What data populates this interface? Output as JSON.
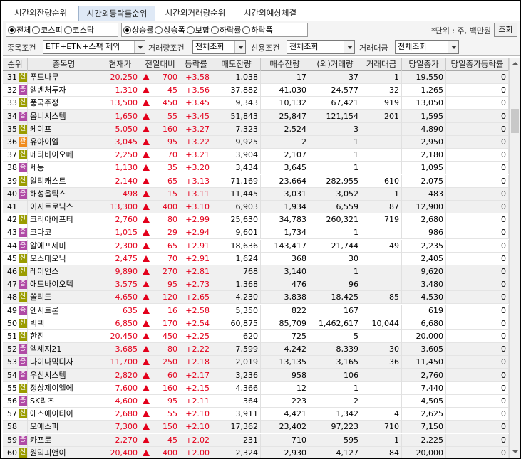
{
  "tabs": [
    {
      "label": "시간외잔량순위",
      "active": false
    },
    {
      "label": "시간외등락률순위",
      "active": true
    },
    {
      "label": "시간외거래량순위",
      "active": false
    },
    {
      "label": "시간외예상체결",
      "active": false
    }
  ],
  "market_options": [
    {
      "label": "전체",
      "selected": true
    },
    {
      "label": "코스피",
      "selected": false
    },
    {
      "label": "코스닥",
      "selected": false
    }
  ],
  "sort_options": [
    {
      "label": "상승률",
      "selected": true
    },
    {
      "label": "상승폭",
      "selected": false
    },
    {
      "label": "보합",
      "selected": false
    },
    {
      "label": "하락률",
      "selected": false
    },
    {
      "label": "하락폭",
      "selected": false
    }
  ],
  "unit_text": "*단위 : 주, 백만원",
  "lookup_button": "조회",
  "filters": {
    "stock_condition_label": "종목조건",
    "stock_condition_value": "ETF+ETN+스팩 제외",
    "volume_condition_label": "거래량조건",
    "volume_condition_value": "전체조회",
    "credit_condition_label": "신용조건",
    "credit_condition_value": "전체조회",
    "amount_label": "거래대금",
    "amount_value": "전체조회"
  },
  "columns": [
    "순위",
    "종목명",
    "현재가",
    "전일대비",
    "등락률",
    "매도잔량",
    "매수잔량",
    "(외)거래량",
    "거래대금",
    "당일종가",
    "당일종가등락률"
  ],
  "badge_colors": {
    "신": "#9a9c00",
    "증": "#b04aa5",
    "관": "#f08c1e"
  },
  "rows": [
    {
      "rank": "31",
      "badge": "신",
      "name": "푸드나무",
      "price": "20,250",
      "change": "700",
      "rate": "+3.58",
      "ask": "1,038",
      "bid": "17",
      "volume": "37",
      "amount": "1",
      "close": "19,550",
      "close_rate": "0",
      "up": true
    },
    {
      "rank": "32",
      "badge": "증",
      "name": "엠벤처투자",
      "price": "1,310",
      "change": "45",
      "rate": "+3.56",
      "ask": "37,882",
      "bid": "41,030",
      "volume": "24,577",
      "amount": "32",
      "close": "1,265",
      "close_rate": "0",
      "up": true
    },
    {
      "rank": "33",
      "badge": "신",
      "name": "풍국주정",
      "price": "13,500",
      "change": "450",
      "rate": "+3.45",
      "ask": "9,343",
      "bid": "10,132",
      "volume": "67,421",
      "amount": "919",
      "close": "13,050",
      "close_rate": "0",
      "up": true
    },
    {
      "rank": "34",
      "badge": "증",
      "name": "옵니시스템",
      "price": "1,650",
      "change": "55",
      "rate": "+3.45",
      "ask": "51,843",
      "bid": "25,847",
      "volume": "121,154",
      "amount": "201",
      "close": "1,595",
      "close_rate": "0",
      "up": true
    },
    {
      "rank": "35",
      "badge": "신",
      "name": "케이프",
      "price": "5,050",
      "change": "160",
      "rate": "+3.27",
      "ask": "7,323",
      "bid": "2,524",
      "volume": "3",
      "amount": "",
      "close": "4,890",
      "close_rate": "0",
      "up": true
    },
    {
      "rank": "36",
      "badge": "관",
      "name": "유아이엘",
      "price": "3,045",
      "change": "95",
      "rate": "+3.22",
      "ask": "9,925",
      "bid": "2",
      "volume": "1",
      "amount": "",
      "close": "2,950",
      "close_rate": "0",
      "up": true
    },
    {
      "rank": "37",
      "badge": "신",
      "name": "메타바이오메",
      "price": "2,250",
      "change": "70",
      "rate": "+3.21",
      "ask": "3,904",
      "bid": "2,107",
      "volume": "1",
      "amount": "",
      "close": "2,180",
      "close_rate": "0",
      "up": true
    },
    {
      "rank": "38",
      "badge": "증",
      "name": "세동",
      "price": "1,130",
      "change": "35",
      "rate": "+3.20",
      "ask": "3,434",
      "bid": "3,645",
      "volume": "1",
      "amount": "",
      "close": "1,095",
      "close_rate": "0",
      "up": true
    },
    {
      "rank": "39",
      "badge": "신",
      "name": "알티캐스트",
      "price": "2,140",
      "change": "65",
      "rate": "+3.13",
      "ask": "71,169",
      "bid": "23,664",
      "volume": "282,955",
      "amount": "610",
      "close": "2,075",
      "close_rate": "0",
      "up": true
    },
    {
      "rank": "40",
      "badge": "증",
      "name": "해성옵틱스",
      "price": "498",
      "change": "15",
      "rate": "+3.11",
      "ask": "11,445",
      "bid": "3,031",
      "volume": "3,052",
      "amount": "1",
      "close": "483",
      "close_rate": "0",
      "up": true
    },
    {
      "rank": "41",
      "badge": "",
      "name": "이지트로닉스",
      "price": "13,300",
      "change": "400",
      "rate": "+3.10",
      "ask": "6,903",
      "bid": "1,934",
      "volume": "6,559",
      "amount": "87",
      "close": "12,900",
      "close_rate": "0",
      "up": true
    },
    {
      "rank": "42",
      "badge": "신",
      "name": "코리아에프티",
      "price": "2,760",
      "change": "80",
      "rate": "+2.99",
      "ask": "25,630",
      "bid": "34,783",
      "volume": "260,321",
      "amount": "719",
      "close": "2,680",
      "close_rate": "0",
      "up": true
    },
    {
      "rank": "43",
      "badge": "증",
      "name": "코다코",
      "price": "1,015",
      "change": "29",
      "rate": "+2.94",
      "ask": "9,601",
      "bid": "1,734",
      "volume": "1",
      "amount": "",
      "close": "986",
      "close_rate": "0",
      "up": true
    },
    {
      "rank": "44",
      "badge": "증",
      "name": "알에프세미",
      "price": "2,300",
      "change": "65",
      "rate": "+2.91",
      "ask": "18,636",
      "bid": "143,417",
      "volume": "21,744",
      "amount": "49",
      "close": "2,235",
      "close_rate": "0",
      "up": true
    },
    {
      "rank": "45",
      "badge": "신",
      "name": "오스테오닉",
      "price": "2,475",
      "change": "70",
      "rate": "+2.91",
      "ask": "1,624",
      "bid": "368",
      "volume": "30",
      "amount": "",
      "close": "2,405",
      "close_rate": "0",
      "up": true
    },
    {
      "rank": "46",
      "badge": "신",
      "name": "레이언스",
      "price": "9,890",
      "change": "270",
      "rate": "+2.81",
      "ask": "768",
      "bid": "3,140",
      "volume": "1",
      "amount": "",
      "close": "9,620",
      "close_rate": "0",
      "up": true
    },
    {
      "rank": "47",
      "badge": "증",
      "name": "애드바이오텍",
      "price": "3,575",
      "change": "95",
      "rate": "+2.73",
      "ask": "1,368",
      "bid": "476",
      "volume": "96",
      "amount": "",
      "close": "3,480",
      "close_rate": "0",
      "up": true
    },
    {
      "rank": "48",
      "badge": "신",
      "name": "쏠리드",
      "price": "4,650",
      "change": "120",
      "rate": "+2.65",
      "ask": "4,230",
      "bid": "3,838",
      "volume": "18,425",
      "amount": "85",
      "close": "4,530",
      "close_rate": "0",
      "up": true
    },
    {
      "rank": "49",
      "badge": "증",
      "name": "엔시트론",
      "price": "635",
      "change": "16",
      "rate": "+2.58",
      "ask": "5,350",
      "bid": "822",
      "volume": "167",
      "amount": "",
      "close": "619",
      "close_rate": "0",
      "up": true
    },
    {
      "rank": "50",
      "badge": "신",
      "name": "빅텍",
      "price": "6,850",
      "change": "170",
      "rate": "+2.54",
      "ask": "60,875",
      "bid": "85,709",
      "volume": "1,462,617",
      "amount": "10,044",
      "close": "6,680",
      "close_rate": "0",
      "up": true
    },
    {
      "rank": "51",
      "badge": "신",
      "name": "한진",
      "price": "20,450",
      "change": "450",
      "rate": "+2.25",
      "ask": "620",
      "bid": "725",
      "volume": "5",
      "amount": "",
      "close": "20,000",
      "close_rate": "0",
      "up": true
    },
    {
      "rank": "52",
      "badge": "증",
      "name": "엑세지21",
      "price": "3,685",
      "change": "80",
      "rate": "+2.22",
      "ask": "7,599",
      "bid": "4,242",
      "volume": "8,339",
      "amount": "30",
      "close": "3,605",
      "close_rate": "0",
      "up": true
    },
    {
      "rank": "53",
      "badge": "증",
      "name": "다이나믹디자",
      "price": "11,700",
      "change": "250",
      "rate": "+2.18",
      "ask": "2,019",
      "bid": "13,135",
      "volume": "3,165",
      "amount": "36",
      "close": "11,450",
      "close_rate": "0",
      "up": true
    },
    {
      "rank": "54",
      "badge": "증",
      "name": "우신시스템",
      "price": "2,820",
      "change": "60",
      "rate": "+2.17",
      "ask": "3,236",
      "bid": "958",
      "volume": "106",
      "amount": "",
      "close": "2,760",
      "close_rate": "0",
      "up": true
    },
    {
      "rank": "55",
      "badge": "신",
      "name": "정상제이엘에",
      "price": "7,600",
      "change": "160",
      "rate": "+2.15",
      "ask": "4,366",
      "bid": "12",
      "volume": "1",
      "amount": "",
      "close": "7,440",
      "close_rate": "0",
      "up": true
    },
    {
      "rank": "56",
      "badge": "증",
      "name": "SK리츠",
      "price": "4,600",
      "change": "95",
      "rate": "+2.11",
      "ask": "364",
      "bid": "223",
      "volume": "2",
      "amount": "",
      "close": "4,505",
      "close_rate": "0",
      "up": true
    },
    {
      "rank": "57",
      "badge": "신",
      "name": "에스에이티이",
      "price": "2,680",
      "change": "55",
      "rate": "+2.10",
      "ask": "3,911",
      "bid": "4,421",
      "volume": "1,342",
      "amount": "4",
      "close": "2,625",
      "close_rate": "0",
      "up": true
    },
    {
      "rank": "58",
      "badge": "",
      "name": "오에스피",
      "price": "7,300",
      "change": "150",
      "rate": "+2.10",
      "ask": "17,362",
      "bid": "23,402",
      "volume": "97,223",
      "amount": "710",
      "close": "7,150",
      "close_rate": "0",
      "up": true
    },
    {
      "rank": "59",
      "badge": "증",
      "name": "카프로",
      "price": "2,270",
      "change": "45",
      "rate": "+2.02",
      "ask": "231",
      "bid": "710",
      "volume": "595",
      "amount": "1",
      "close": "2,225",
      "close_rate": "0",
      "up": true
    },
    {
      "rank": "60",
      "badge": "신",
      "name": "원익피앤이",
      "price": "20,400",
      "change": "400",
      "rate": "+2.00",
      "ask": "2,324",
      "bid": "2,930",
      "volume": "4,127",
      "amount": "84",
      "close": "20,000",
      "close_rate": "0",
      "up": true
    }
  ]
}
